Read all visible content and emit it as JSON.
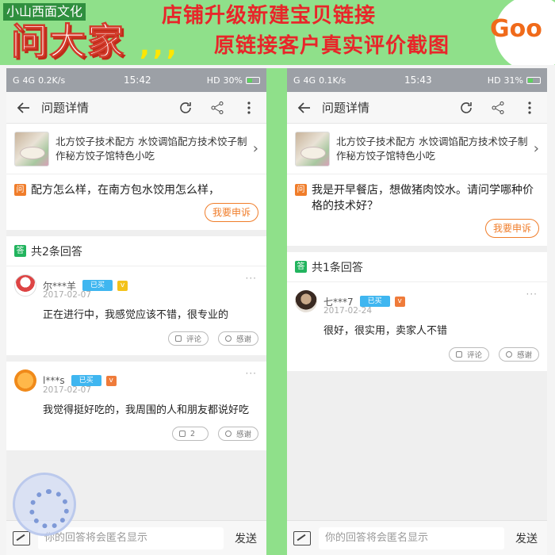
{
  "banner": {
    "shop_name": "小山西面文化",
    "big_text": "问大家",
    "dots": ",,,",
    "headline1": "店铺升级新建宝贝链接",
    "headline2": "原链接客户真实评价截图",
    "logo_text": "Goo"
  },
  "left": {
    "status": {
      "carrier": "G",
      "signal": "4G",
      "speed": "0.2K/s",
      "time": "15:42",
      "hd": "HD",
      "battery": "30%"
    },
    "nav": {
      "title": "问题详情"
    },
    "product": {
      "title": "北方饺子技术配方 水饺调馅配方技术饺子制作秘方饺子馆特色小吃"
    },
    "question": {
      "badge": "问",
      "text": "配方怎么样，在南方包水饺用怎么样，",
      "appeal": "我要申诉"
    },
    "answers_count": "共2条回答",
    "answer_badge": "答",
    "answers": [
      {
        "user": "尔***羊",
        "bought": "已买",
        "date": "2017-02-07",
        "body": "正在进行中，我感觉应该不错，很专业的",
        "comment": "评论",
        "thanks": "感谢"
      },
      {
        "user": "l***s",
        "bought": "已买",
        "date": "2017-02-07",
        "body": "我觉得挺好吃的，我周围的人和朋友都说好吃",
        "comment": "2",
        "thanks": "感谢"
      }
    ],
    "input_placeholder": "你的回答将会匿名显示",
    "send": "发送"
  },
  "right": {
    "status": {
      "carrier": "G",
      "signal": "4G",
      "speed": "0.1K/s",
      "time": "15:43",
      "hd": "HD",
      "battery": "31%"
    },
    "nav": {
      "title": "问题详情"
    },
    "product": {
      "title": "北方饺子技术配方 水饺调馅配方技术饺子制作秘方饺子馆特色小吃"
    },
    "question": {
      "badge": "问",
      "text": "我是开早餐店，想做猪肉饺水。请问学哪种价格的技术好？",
      "appeal": "我要申诉"
    },
    "answers_count": "共1条回答",
    "answer_badge": "答",
    "answers": [
      {
        "user": "七***7",
        "bought": "已买",
        "date": "2017-02-24",
        "body": "很好，很实用，卖家人不错",
        "comment": "评论",
        "thanks": "感谢"
      }
    ],
    "input_placeholder": "你的回答将会匿名显示",
    "send": "发送"
  },
  "colors": {
    "banner_bg": "#8fe08a",
    "accent_orange": "#f07d2a",
    "answer_green": "#22b45e",
    "bought_blue": "#3fb6f0",
    "headline_red": "#e8262a"
  },
  "icons": [
    "back-arrow-icon",
    "refresh-icon",
    "share-icon",
    "more-vertical-icon",
    "chevron-right-icon",
    "comment-icon",
    "thanks-icon",
    "edit-icon"
  ]
}
